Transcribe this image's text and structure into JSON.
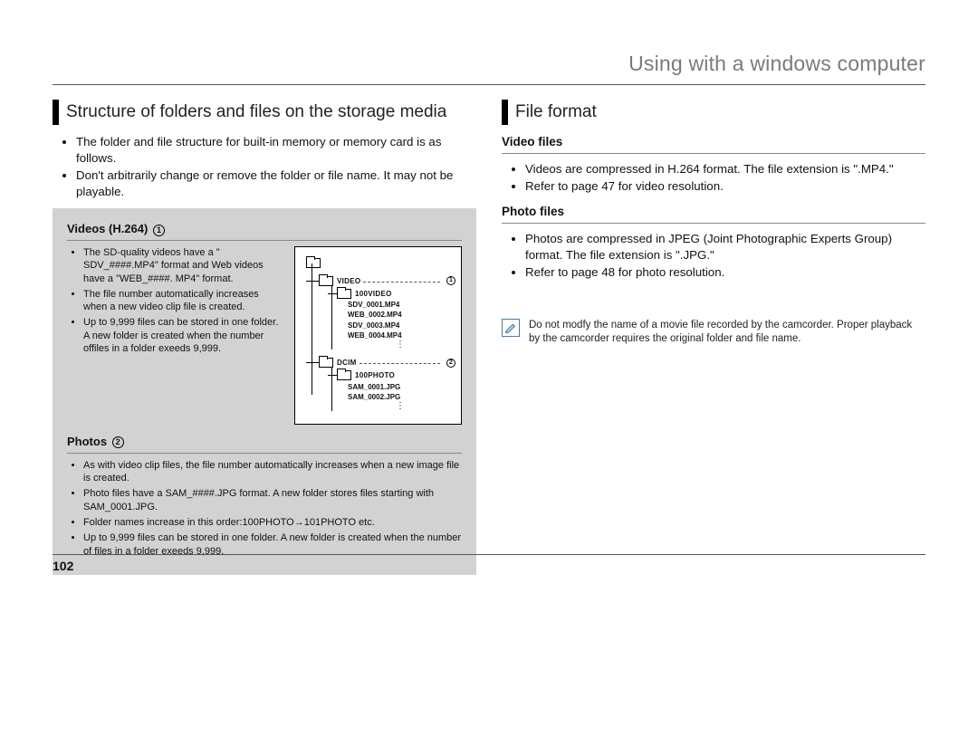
{
  "header": "Using with a windows computer",
  "pageNumber": "102",
  "left": {
    "title": "Structure of folders and files on the storage media",
    "intro": [
      "The folder and file structure for built-in memory or memory card is as follows.",
      "Don't arbitrarily change or remove the folder or file name. It may not be playable."
    ],
    "section1": {
      "heading": "Videos (H.264)",
      "badge": "1",
      "bullets": [
        "The SD-quality videos have a \" SDV_####.MP4\" format and Web videos have a \"WEB_####. MP4\" format.",
        "The file number automatically increases when a new video clip file is created.",
        "Up to 9,999 files can be stored in one folder. A new folder is created when the number offiles in a folder exeeds 9,999."
      ]
    },
    "section2": {
      "heading": "Photos",
      "badge": "2",
      "bullets": [
        "As with video clip files, the file number automatically increases when a new image file is created.",
        "Photo files have a SAM_####.JPG format. A new folder stores files starting with SAM_0001.JPG.",
        "Folder names increase in this order:100PHOTO→101PHOTO etc.",
        "Up to 9,999 files can be stored in one folder. A new folder is created when the number of files in a folder exeeds 9,999."
      ]
    },
    "tree": {
      "videoFolder": "VIDEO",
      "videoBadge": "1",
      "videoSub": "100VIDEO",
      "videoFiles": [
        "SDV_0001.MP4",
        "WEB_0002.MP4",
        "SDV_0003.MP4",
        "WEB_0004.MP4"
      ],
      "dcimFolder": "DCIM",
      "dcimBadge": "2",
      "photoSub": "100PHOTO",
      "photoFiles": [
        "SAM_0001.JPG",
        "SAM_0002.JPG"
      ]
    }
  },
  "right": {
    "title": "File format",
    "videoHeading": "Video files",
    "videoBullets": [
      "Videos are compressed in H.264 format. The file extension is \".MP4.\"",
      "Refer to page 47 for video resolution."
    ],
    "photoHeading": "Photo files",
    "photoBullets": [
      "Photos are compressed in JPEG (Joint Photographic Experts Group) format. The file extension is \".JPG.\"",
      "Refer to page 48 for photo resolution."
    ],
    "note": "Do not modfy the name of a movie file recorded by the camcorder. Proper playback by the camcorder requires the original folder and file name."
  }
}
